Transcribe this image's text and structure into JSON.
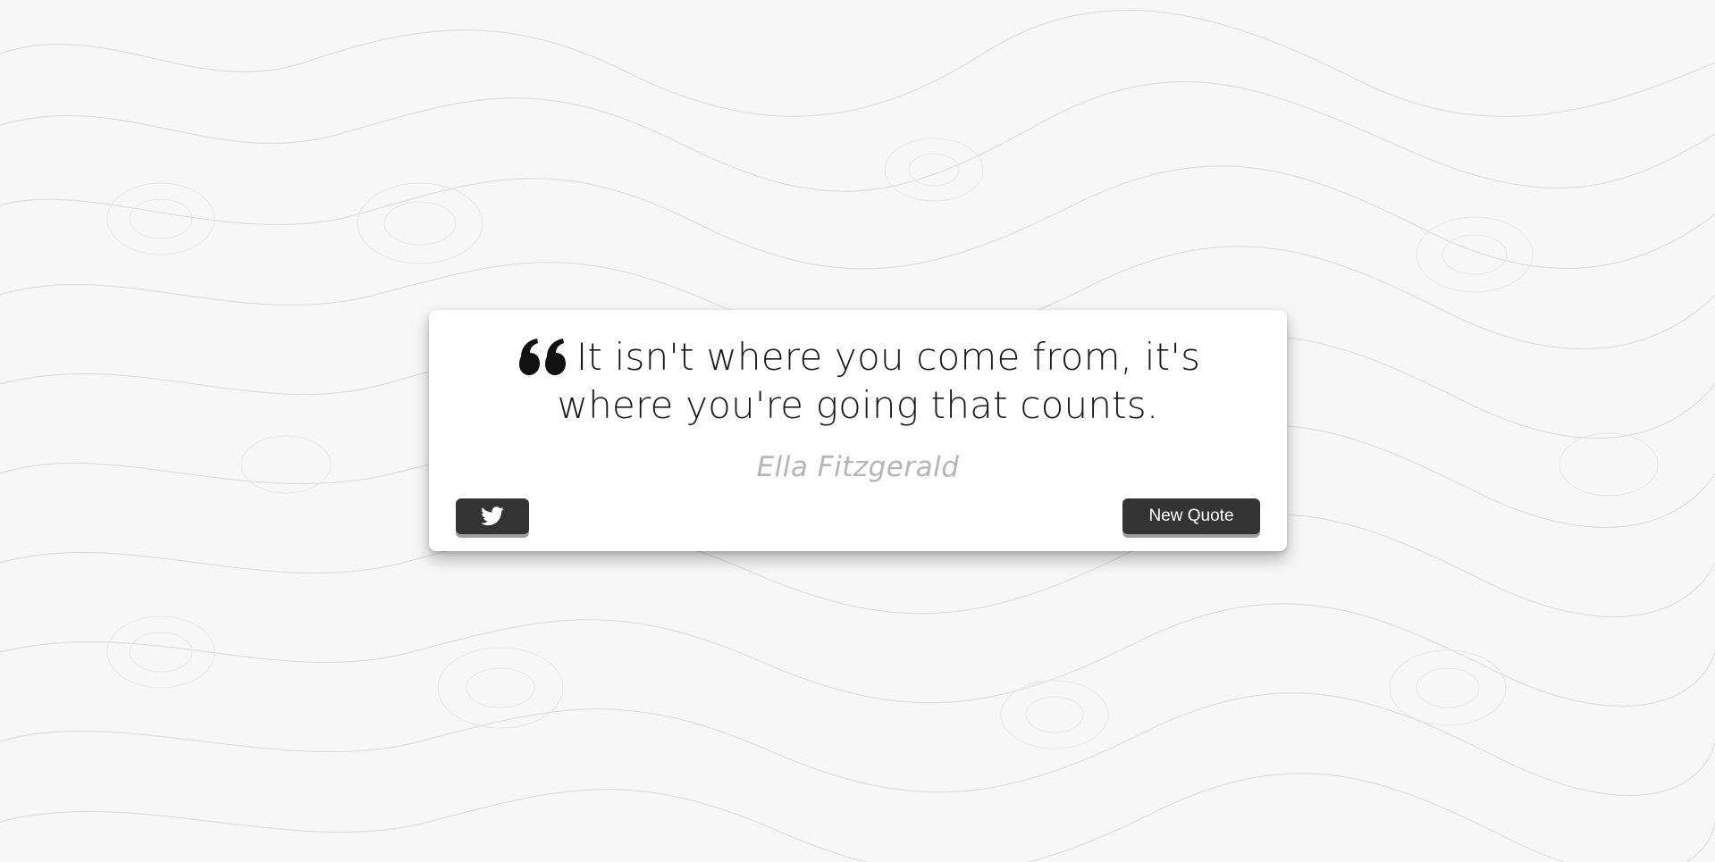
{
  "quote": {
    "text": "It isn't where you come from, it's where you're going that counts.",
    "author": "Ella Fitzgerald"
  },
  "buttons": {
    "tweet_icon": "twitter-icon",
    "new_quote_label": "New Quote"
  },
  "colors": {
    "background": "#f7f7f7",
    "card": "#ffffff",
    "button": "#333333",
    "button_shadow": "#9e9e9e",
    "quote_text": "#1a1a1a",
    "author_text": "#b5b5b5"
  }
}
